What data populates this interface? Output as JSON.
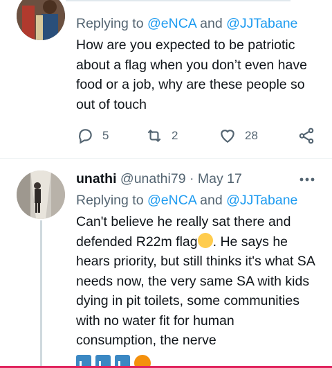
{
  "tweet1": {
    "replying_prefix": "Replying to ",
    "mention1": "@eNCA",
    "and_text": " and ",
    "mention2": "@JJTabane",
    "text": "How are you expected to be patriotic about a flag when you don’t even have food or a job, why are these people so out of touch",
    "actions": {
      "reply_count": "5",
      "retweet_count": "2",
      "like_count": "28"
    }
  },
  "tweet2": {
    "display_name": "unathi",
    "handle": "@unathi79",
    "separator": " · ",
    "date": "May 17",
    "replying_prefix": "Replying to ",
    "mention1": "@eNCA",
    "and_text": " and ",
    "mention2": "@JJTabane",
    "text_part1": "Can't believe he really sat there and defended R22m flag",
    "text_part2": ". He says he hears priority, but still thinks it's what SA needs now, the very same SA with kids dying in pit toilets, some communities with no water fit for human consumption, the nerve"
  },
  "icons": {
    "reply": "reply-icon",
    "retweet": "retweet-icon",
    "like": "heart-icon",
    "share": "share-icon",
    "more": "more-icon"
  },
  "colors": {
    "link": "#1d9bf0",
    "secondary": "#536471",
    "text": "#0f1419"
  }
}
